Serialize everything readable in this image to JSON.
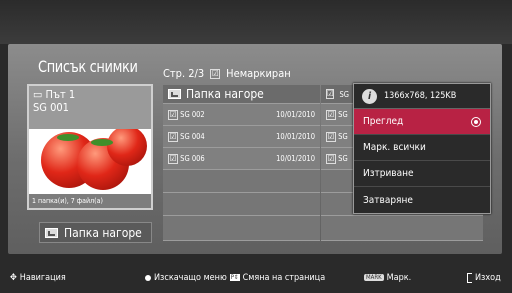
{
  "screen": {
    "title": "Списък снимки"
  },
  "page_info": {
    "page": "Стр. 2/3",
    "unmarked": "Немаркиран"
  },
  "preview": {
    "path": "Път 1",
    "name": "SG 001",
    "stats": "1 папка(и), 7 файл(а)"
  },
  "folder_up_button": "Папка нагоре",
  "list": {
    "up_label": "Папка нагоре",
    "rows": [
      {
        "name": "SG 002",
        "date": "10/01/2010",
        "right": "SG"
      },
      {
        "name": "SG 004",
        "date": "10/01/2010",
        "right": "SG"
      },
      {
        "name": "SG 006",
        "date": "10/01/2010",
        "right": "SG"
      }
    ],
    "up_right": "SG"
  },
  "context_menu": {
    "info": "1366x768, 125KB",
    "items": [
      "Преглед",
      "Марк. всички",
      "Изтриване",
      "Затваряне"
    ],
    "selected": "Преглед"
  },
  "footer": {
    "navigation": "Навигация",
    "popup": "Изскачащо меню",
    "page_change": "Смяна на страница",
    "mark_badge": "MARK",
    "mark": "Марк.",
    "exit": "Изход"
  },
  "colors": {
    "selected": "#b82244",
    "panel": "#7a7a7a"
  }
}
